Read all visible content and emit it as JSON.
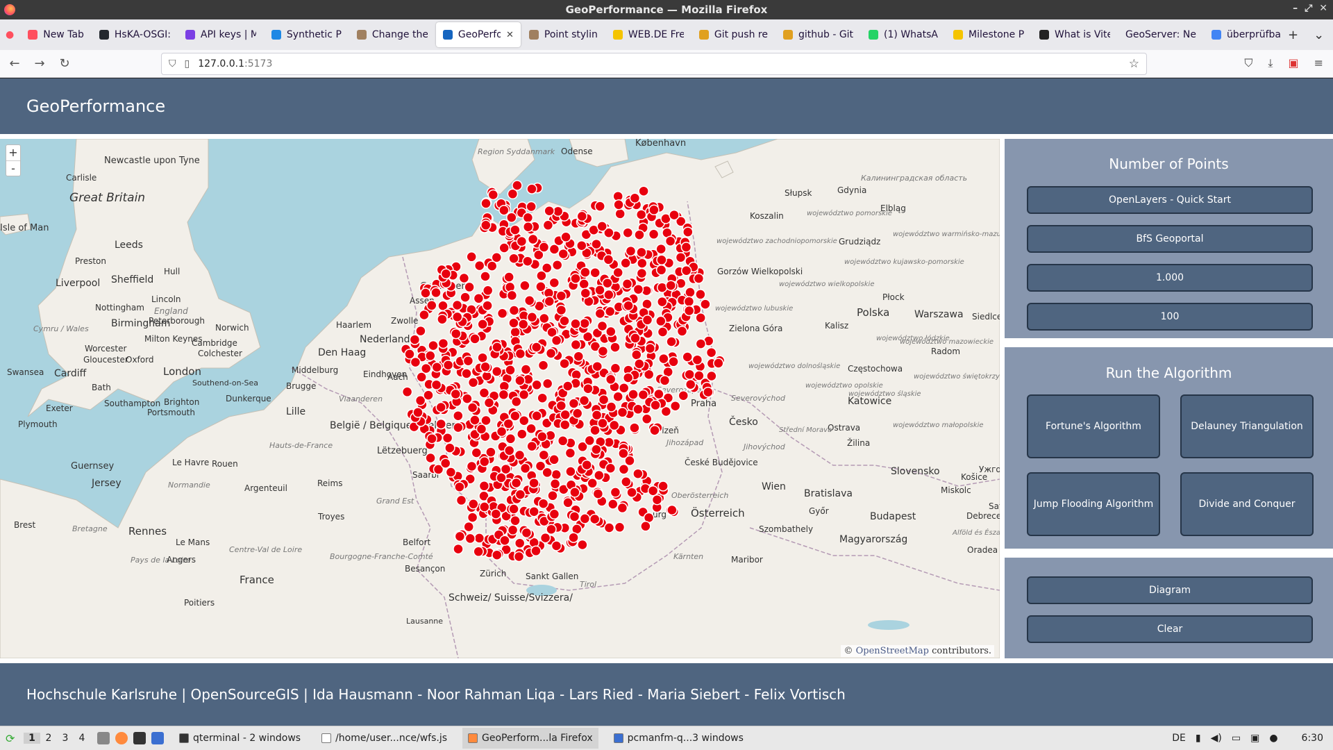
{
  "window": {
    "title": "GeoPerformance — Mozilla Firefox"
  },
  "tabs": [
    {
      "label": "New Tab",
      "color": "#ff4f5e"
    },
    {
      "label": "HsKA-OSGI:",
      "color": "#24292f"
    },
    {
      "label": "API keys | M",
      "color": "#7b3fe4"
    },
    {
      "label": "Synthetic P",
      "color": "#1e88e5"
    },
    {
      "label": "Change the",
      "color": "#a08060"
    },
    {
      "label": "GeoPerfo",
      "color": "#1565c0",
      "active": true
    },
    {
      "label": "Point stylin",
      "color": "#a08060"
    },
    {
      "label": "WEB.DE Fre",
      "color": "#f5c400"
    },
    {
      "label": "Git push re",
      "color": "#e0a020"
    },
    {
      "label": "github - Git",
      "color": "#e0a020"
    },
    {
      "label": "(1) WhatsA",
      "color": "#25d366"
    },
    {
      "label": "Milestone P",
      "color": "#f5c400"
    },
    {
      "label": "What is Vite",
      "color": "#222222"
    },
    {
      "label": "GeoServer: Ne",
      "color": ""
    },
    {
      "label": "überprüfba",
      "color": "#4285f4"
    }
  ],
  "navbar": {
    "url_host": "127.0.0.1",
    "url_port": ":5173"
  },
  "app": {
    "title": "GeoPerformance",
    "footer": "Hochschule Karlsruhe | OpenSourceGIS | Ida Hausmann - Noor Rahman Liqa - Lars Ried - Maria Siebert - Felix Vortisch"
  },
  "map": {
    "zoom_in": "+",
    "zoom_out": "-",
    "attribution_prefix": "©",
    "attribution_link": "OpenStreetMap",
    "attribution_suffix": "contributors.",
    "point_color": "#e8000e",
    "labels": {
      "great_britain": "Great Britain",
      "newcastle": "Newcastle upon Tyne",
      "carlisle": "Carlisle",
      "isle_of_man": "Isle of Man",
      "leeds": "Leeds",
      "preston": "Preston",
      "liverpool": "Liverpool",
      "sheffield": "Sheffield",
      "hull": "Hull",
      "lincoln": "Lincoln",
      "england": "England",
      "nottingham": "Nottingham",
      "birmingham": "Birmingham",
      "peterborough": "Peterborough",
      "norwich": "Norwich",
      "cymru": "Cymru / Wales",
      "milton_keynes": "Milton Keynes",
      "cambridge": "Cambridge",
      "worcester": "Worcester",
      "colchester": "Colchester",
      "gloucester": "Gloucester",
      "oxford": "Oxford",
      "london": "London",
      "swansea": "Swansea",
      "cardiff": "Cardiff",
      "southend": "Southend-on-Sea",
      "bath": "Bath",
      "exeter": "Exeter",
      "southampton": "Southampton",
      "brighton": "Brighton",
      "portsmouth": "Portsmouth",
      "plymouth": "Plymouth",
      "guernsey": "Guernsey",
      "jersey": "Jersey",
      "le_havre": "Le Havre",
      "rouen": "Rouen",
      "normandie": "Normandie",
      "brest": "Brest",
      "bretagne": "Bretagne",
      "rennes": "Rennes",
      "le_mans": "Le Mans",
      "pays_de_la_loire": "Pays de la Loire",
      "angers": "Angers",
      "france": "France",
      "centre_val": "Centre-Val de Loire",
      "poitiers": "Poitiers",
      "argenteuil": "Argenteuil",
      "reims": "Reims",
      "troyes": "Troyes",
      "hauts_de_france": "Hauts-de-France",
      "grand_est": "Grand Est",
      "lille": "Lille",
      "dunkerque": "Dunkerque",
      "brugge": "Brugge",
      "middelburg": "Middelburg",
      "den_haag": "Den Haag",
      "haarlem": "Haarlem",
      "nederland": "Nederland",
      "zwolle": "Zwolle",
      "assen": "Assen",
      "groningen": "Groningen",
      "eindhoven": "Eindhoven",
      "vlaanderen": "Vlaanderen",
      "belgie": "België / Belgique / Belgien",
      "letzebuerg": "Lëtzebuerg",
      "bourgogne": "Bourgogne-Franche-Comté",
      "besancon": "Besançon",
      "belfort": "Belfort",
      "zurich": "Zürich",
      "schweiz": "Schweiz/ Suisse/Svizzera/",
      "sankt_gallen": "Sankt Gallen",
      "tirol": "Tirol",
      "lausanne": "Lausanne",
      "kobenhavn": "København",
      "odense": "Odense",
      "syddanmark": "Region Syddanmark",
      "kaliningrad": "Калининградская область",
      "slupsk": "Słupsk",
      "gdynia": "Gdynia",
      "elblag": "Elbląg",
      "koszalin": "Koszalin",
      "pomorskie": "województwo pomorskie",
      "zachodniopomorskie": "województwo zachodniopomorskie",
      "warminsko": "województwo warmińsko-mazurskie",
      "grudziadz": "Grudziądz",
      "kujawsko": "województwo kujawsko-pomorskie",
      "gorzow": "Gorzów Wielkopolski",
      "wielkopolskie": "województwo wielkopolskie",
      "plock": "Płock",
      "polska": "Polska",
      "warszawa": "Warszawa",
      "siedlce": "Siedlce",
      "lubuskie": "województwo lubuskie",
      "kalisz": "Kalisz",
      "lodzkie": "województwo łódzkie",
      "zielona_gora": "Zielona Góra",
      "mazowieckie": "województwo mazowieckie",
      "radom": "Radom",
      "dolnoslaskie": "województwo dolnośląskie",
      "czestochowa": "Częstochowa",
      "swietokrzyskie": "województwo świętokrzyskie",
      "opolskie": "województwo opolskie",
      "slaskie": "województwo śląskie",
      "katowice": "Katowice",
      "malopolskie": "województwo małopolskie",
      "severozapad": "Severozápad",
      "praha": "Praha",
      "severovychod": "Severovýchod",
      "cesko": "Česko",
      "ostrava": "Ostrava",
      "plzen": "Plzeň",
      "stredni_morava": "Střední Morava",
      "jihozapad": "Jihozápad",
      "jihovychod": "Jihovýchod",
      "zilina": "Žilina",
      "ceske_budejovice": "České Budějovice",
      "slovensko": "Slovensko",
      "kosice": "Košice",
      "uzhorod": "Ужгоро",
      "wien": "Wien",
      "bratislava": "Bratislava",
      "miskolc": "Miskolc",
      "oberosterreich": "Oberösterreich",
      "osterreich": "Österreich",
      "gyor": "Győr",
      "budapest": "Budapest",
      "debrecen": "Debrecen",
      "szombathely": "Szombathely",
      "magyarorszag": "Magyarország",
      "alfold": "Alföld és Észak",
      "sat": "Sat",
      "oradea": "Oradea",
      "karnten": "Kärnten",
      "maribor": "Maribor",
      "aach": "Aach",
      "saarbr": "Saarbr",
      "urg": "urg"
    }
  },
  "panel_points": {
    "heading": "Number of Points",
    "buttons": [
      "OpenLayers - Quick Start",
      "BfS Geoportal",
      "1.000",
      "100"
    ]
  },
  "panel_algorithm": {
    "heading": "Run the Algorithm",
    "buttons": [
      "Fortune's Algorithm",
      "Delauney Triangulation",
      "Jump Flooding Algorithm",
      "Divide and Conquer"
    ]
  },
  "panel_actions": {
    "buttons": [
      "Diagram",
      "Clear"
    ]
  },
  "taskbar": {
    "workspaces": [
      "1",
      "2",
      "3",
      "4"
    ],
    "tasks": [
      {
        "label": "qterminal - 2 windows"
      },
      {
        "label": "/home/user...nce/wfs.js"
      },
      {
        "label": "GeoPerform...la Firefox",
        "active": true
      },
      {
        "label": "pcmanfm-q...3 windows"
      }
    ],
    "keyboard": "DE",
    "clock": "6:30"
  }
}
